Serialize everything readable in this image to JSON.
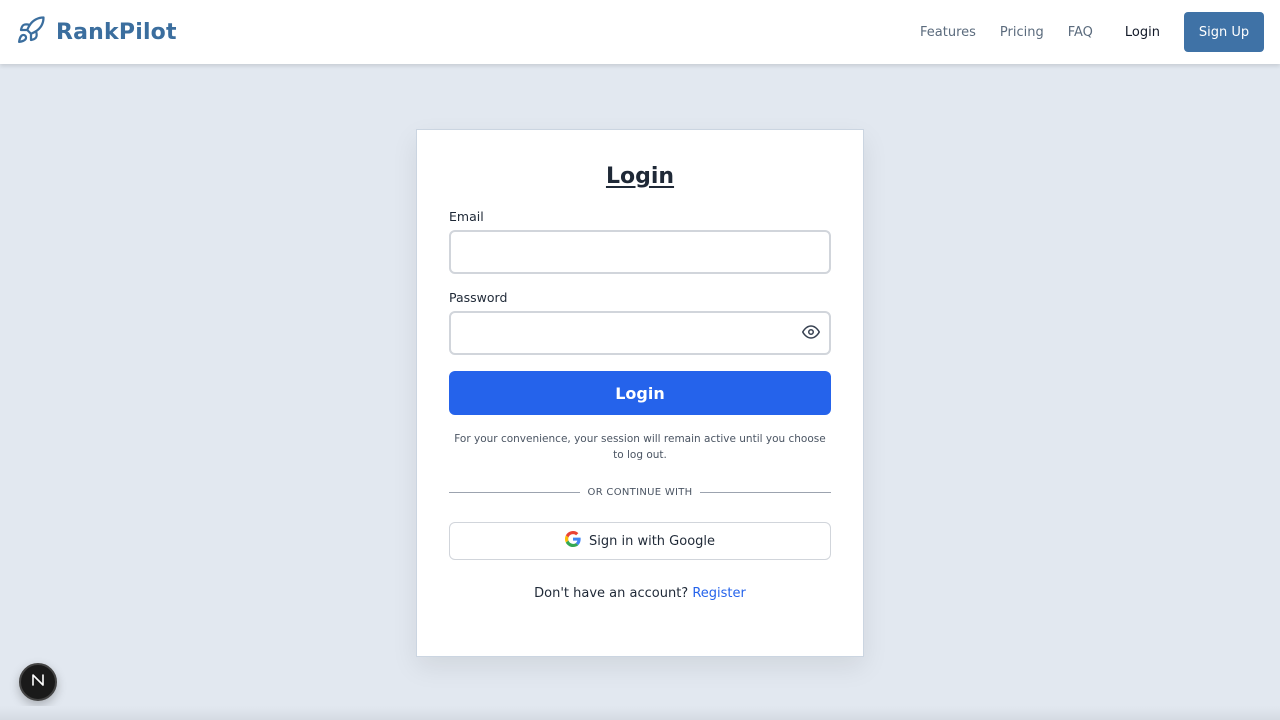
{
  "nav": {
    "brand": "RankPilot",
    "links": [
      "Features",
      "Pricing",
      "FAQ"
    ],
    "login": "Login",
    "signup": "Sign Up",
    "brand_color": "#3b6e9e"
  },
  "form": {
    "title": "Login",
    "email_label": "Email",
    "email_value": "",
    "password_label": "Password",
    "password_value": "",
    "submit": "Login",
    "session_note": "For your convenience, your session will remain active until you choose to log out.",
    "divider": "OR CONTINUE WITH",
    "google_button": "Sign in with Google",
    "register_prompt": "Don't have an account?",
    "register_link": "Register",
    "accent_color": "#2563eb"
  },
  "icons": {
    "brand": "rocket-icon",
    "password_toggle": "eye-icon",
    "google": "google-icon",
    "dev_badge": "n-logo-icon"
  }
}
